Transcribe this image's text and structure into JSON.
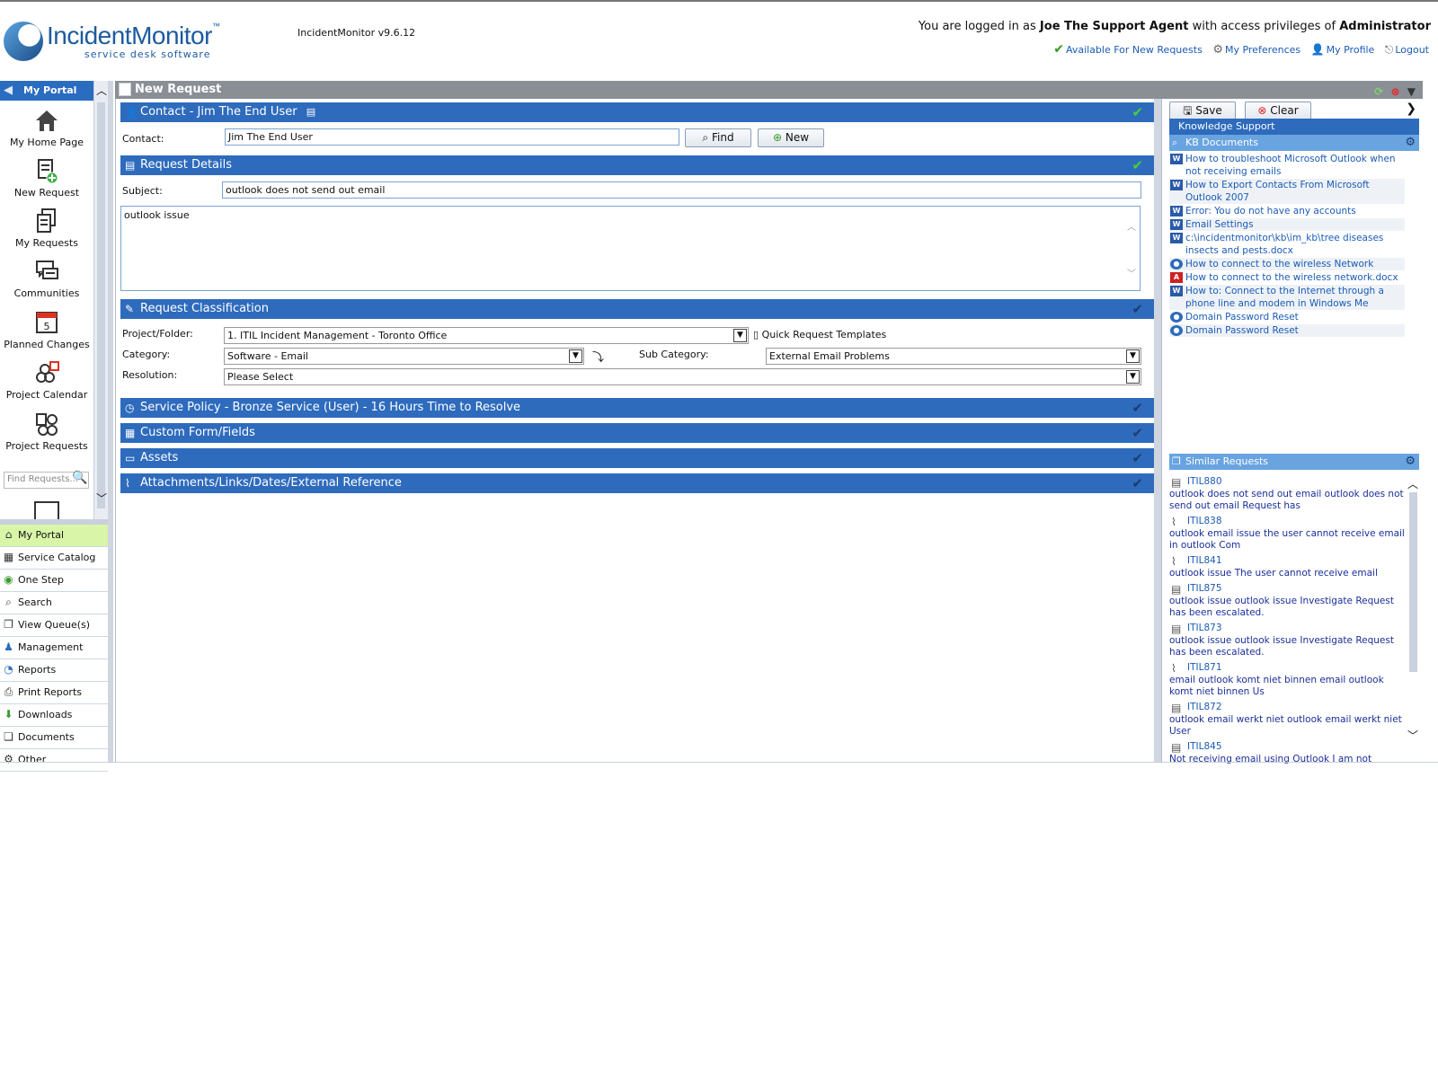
{
  "header": {
    "logo_name": "IncidentMonitor",
    "logo_tm": "™",
    "logo_sub": "service desk software",
    "version": "IncidentMonitor v9.6.12",
    "login_prefix": "You are logged in as",
    "user": "Joe The Support Agent",
    "login_mid": "with access privileges of",
    "role": "Administrator",
    "links": {
      "available": "Available For New Requests",
      "preferences": "My Preferences",
      "profile": "My Profile",
      "logout": "Logout"
    }
  },
  "left": {
    "title": "My Portal",
    "items": [
      {
        "label": "My Home Page",
        "icon": "home-icon"
      },
      {
        "label": "New Request",
        "icon": "new-request-icon"
      },
      {
        "label": "My Requests",
        "icon": "my-requests-icon"
      },
      {
        "label": "Communities",
        "icon": "communities-icon"
      },
      {
        "label": "Planned Changes",
        "icon": "calendar-icon",
        "badge": "5"
      },
      {
        "label": "Project Calendar",
        "icon": "project-calendar-icon"
      },
      {
        "label": "Project Requests",
        "icon": "project-requests-icon"
      }
    ],
    "find_placeholder": "Find Requests..."
  },
  "nav": [
    {
      "label": "My Portal",
      "icon": "home-icon"
    },
    {
      "label": "Service Catalog",
      "icon": "catalog-icon"
    },
    {
      "label": "One Step",
      "icon": "one-step-icon"
    },
    {
      "label": "Search",
      "icon": "search-icon"
    },
    {
      "label": "View Queue(s)",
      "icon": "queue-icon"
    },
    {
      "label": "Management",
      "icon": "management-icon"
    },
    {
      "label": "Reports",
      "icon": "reports-icon"
    },
    {
      "label": "Print Reports",
      "icon": "print-icon"
    },
    {
      "label": "Downloads",
      "icon": "download-icon"
    },
    {
      "label": "Documents",
      "icon": "documents-icon"
    },
    {
      "label": "Other",
      "icon": "gear-icon"
    }
  ],
  "main": {
    "title": "New Request",
    "contact_section": "Contact - Jim The End User",
    "contact_label": "Contact:",
    "contact_value": "Jim The End User",
    "find_label": "Find",
    "new_label": "New",
    "details_section": "Request Details",
    "subject_label": "Subject:",
    "subject_value": "outlook does not send out email",
    "description_value": "outlook issue",
    "classification_section": "Request Classification",
    "project_label": "Project/Folder:",
    "project_value": "1. ITIL Incident Management - Toronto Office",
    "quick_templates": "Quick Request Templates",
    "category_label": "Category:",
    "category_value": "Software - Email",
    "subcategory_label": "Sub Category:",
    "subcategory_value": "External Email Problems",
    "resolution_label": "Resolution:",
    "resolution_value": "Please Select",
    "service_policy_section": "Service Policy - Bronze Service (User) - 16 Hours Time to Resolve",
    "custom_form_section": "Custom Form/Fields",
    "assets_section": "Assets",
    "attachments_section": "Attachments/Links/Dates/External Reference"
  },
  "right": {
    "save_label": "Save",
    "clear_label": "Clear",
    "knowledge_support": "Knowledge Support",
    "kb_title": "KB Documents",
    "kb_docs": [
      {
        "text": "How to troubleshoot Microsoft Outlook when not receiving emails",
        "type": "word"
      },
      {
        "text": "How to Export Contacts From Microsoft Outlook 2007",
        "type": "word"
      },
      {
        "text": "Error: You do not have any accounts",
        "type": "word"
      },
      {
        "text": "Email Settings",
        "type": "word"
      },
      {
        "text": "c:\\incidentmonitor\\kb\\im_kb\\tree diseases insects and pests.docx",
        "type": "word"
      },
      {
        "text": "How to connect to the wireless Network",
        "type": "user"
      },
      {
        "text": "How to connect to the wireless network.docx",
        "type": "pdf"
      },
      {
        "text": "How to: Connect to the Internet through a phone line and modem in Windows Me",
        "type": "word"
      },
      {
        "text": "Domain Password Reset",
        "type": "user"
      },
      {
        "text": "Domain Password Reset",
        "type": "user"
      }
    ],
    "similar_title": "Similar Requests",
    "similar": [
      {
        "id": "ITIL880",
        "text": "outlook does not send out email outlook does not send out email Request has",
        "icon": "document-icon"
      },
      {
        "id": "ITIL838",
        "text": "outlook email issue the user cannot receive email in outlook Com",
        "icon": "paperclip-icon"
      },
      {
        "id": "ITIL841",
        "text": "outlook issue The user cannot receive email",
        "icon": "paperclip-icon"
      },
      {
        "id": "ITIL875",
        "text": "outlook issue outlook issue Investigate Request has been escalated.",
        "icon": "document-icon"
      },
      {
        "id": "ITIL873",
        "text": "outlook issue outlook issue Investigate Request has been escalated.",
        "icon": "document-icon"
      },
      {
        "id": "ITIL871",
        "text": "email outlook komt niet binnen email outlook komt niet binnen Us",
        "icon": "paperclip-icon"
      },
      {
        "id": "ITIL872",
        "text": "outlook email werkt niet outlook email werkt niet User",
        "icon": "document-icon"
      },
      {
        "id": "ITIL845",
        "text": "Not receiving email using Outlook I am not receiving",
        "icon": "document-icon"
      }
    ]
  }
}
